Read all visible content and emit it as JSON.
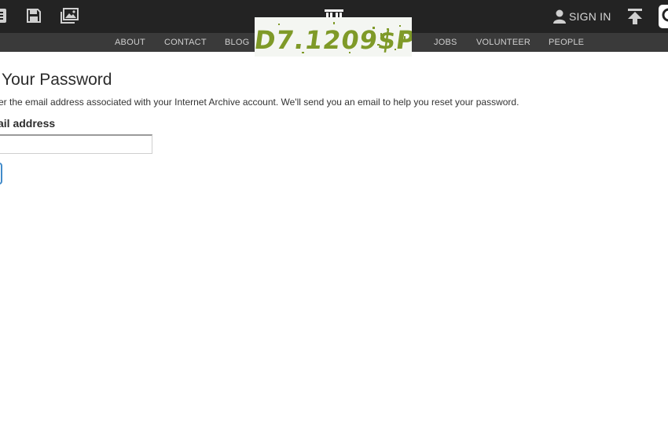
{
  "header": {
    "icons": [
      "book-icon",
      "floppy-disk-icon",
      "image-gallery-icon"
    ],
    "logo_icon": "archive-building-icon",
    "sign_in_label": "SIGN IN",
    "upload_icon": "upload-arrow-icon",
    "search_icon": "search-icon"
  },
  "subnav": {
    "items": [
      {
        "label": "ABOUT"
      },
      {
        "label": "CONTACT"
      },
      {
        "label": "BLOG"
      },
      {
        "label": "JOBS"
      },
      {
        "label": "VOLUNTEER"
      },
      {
        "label": "PEOPLE"
      }
    ]
  },
  "captcha_overlay": {
    "text": "D7.1209$P"
  },
  "main": {
    "title": "Your Password",
    "instructions": "er the email address associated with your Internet Archive account. We'll send you an email to help you reset your password.",
    "email_label": "ail address",
    "email_value": "",
    "email_placeholder": ""
  },
  "colors": {
    "topbar": "#232323",
    "subnav": "#3a3a3a",
    "captcha_ink": "#7f9a28",
    "button_border": "#428bca"
  }
}
